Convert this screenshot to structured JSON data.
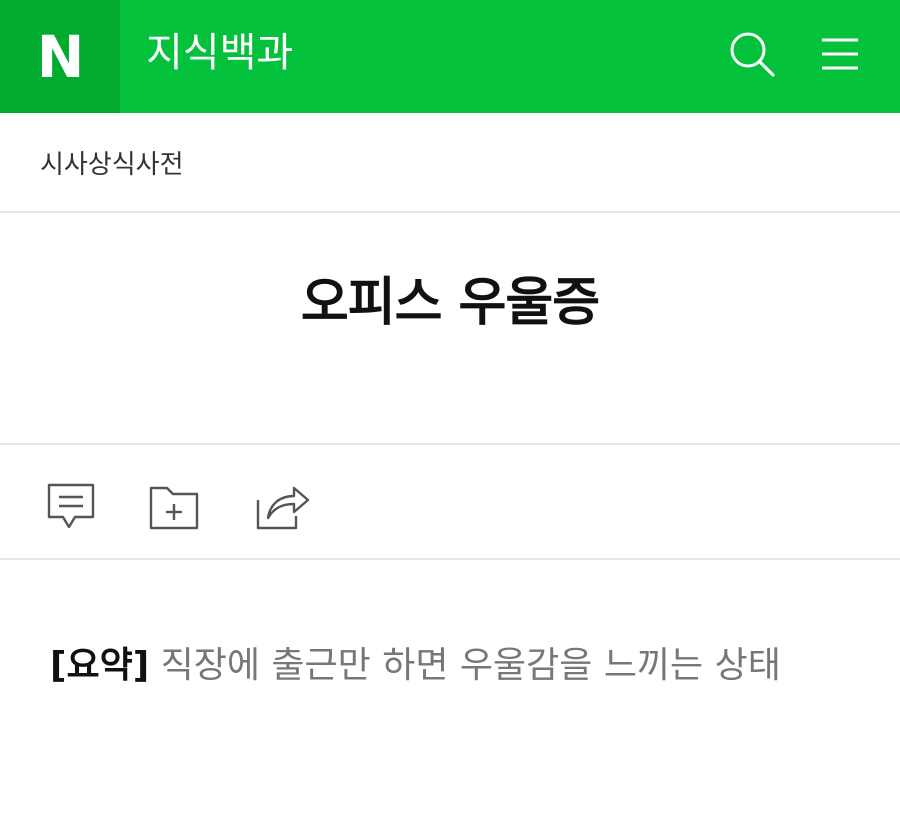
{
  "header": {
    "logo_text": "N",
    "app_title": "지식백과",
    "search_icon": "search-icon",
    "menu_icon": "hamburger-menu-icon",
    "brand_color": "#03c13b",
    "logo_bg_color": "#00ab2e"
  },
  "breadcrumb": {
    "category": "시사상식사전"
  },
  "article": {
    "title": "오피스 우울증",
    "summary_label": "[요약]",
    "summary_text": " 직장에 출근만 하면 우울감을 느끼는 상태"
  },
  "actions": [
    {
      "name": "comment",
      "icon": "comment-icon"
    },
    {
      "name": "save-to-folder",
      "icon": "folder-plus-icon"
    },
    {
      "name": "share",
      "icon": "share-icon"
    }
  ]
}
